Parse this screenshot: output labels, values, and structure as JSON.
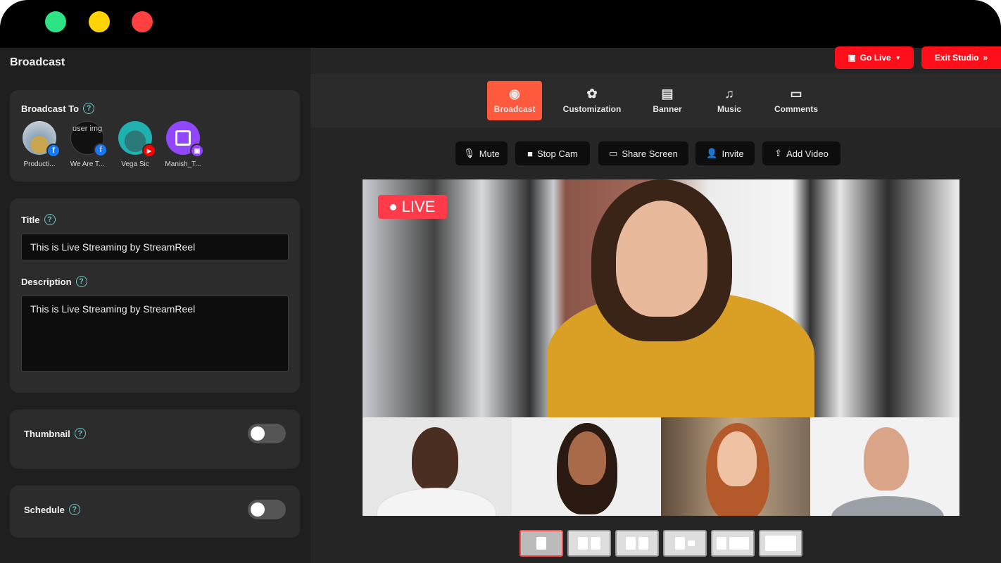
{
  "window": {
    "dot_colors": [
      "#2ee383",
      "#ffd400",
      "#ff4040"
    ]
  },
  "sidebar": {
    "heading": "Broadcast",
    "broadcast_to": {
      "label": "Broadcast To",
      "accounts": [
        {
          "name": "Producti...",
          "platform": "facebook-icon",
          "badge": "f"
        },
        {
          "name": "We Are T...",
          "platform": "facebook-icon",
          "badge": "f",
          "alt": "user img"
        },
        {
          "name": "Vega Sic",
          "platform": "youtube-icon",
          "badge": "▶"
        },
        {
          "name": "Manish_T...",
          "platform": "twitch-icon",
          "badge": "▣"
        }
      ]
    },
    "title": {
      "label": "Title",
      "value": "This is Live Streaming by StreamReel"
    },
    "description": {
      "label": "Description",
      "value": "This is Live Streaming by StreamReel"
    },
    "thumbnail": {
      "label": "Thumbnail",
      "enabled": false
    },
    "schedule": {
      "label": "Schedule",
      "enabled": false
    }
  },
  "header_buttons": {
    "go_live": "Go Live",
    "exit_studio": "Exit Studio"
  },
  "tabs": [
    {
      "label": "Broadcast",
      "icon": "broadcast-icon",
      "active": true
    },
    {
      "label": "Customization",
      "icon": "palette-icon"
    },
    {
      "label": "Banner",
      "icon": "banner-icon"
    },
    {
      "label": "Music",
      "icon": "music-icon"
    },
    {
      "label": "Comments",
      "icon": "comment-icon"
    }
  ],
  "controls": [
    {
      "label": "Mute",
      "icon": "microphone-icon"
    },
    {
      "label": "Stop Cam",
      "icon": "camera-icon"
    },
    {
      "label": "Share Screen",
      "icon": "monitor-icon"
    },
    {
      "label": "Invite",
      "icon": "add-user-icon"
    },
    {
      "label": "Add Video",
      "icon": "upload-icon"
    }
  ],
  "stage": {
    "live_label": "LIVE"
  },
  "layouts": {
    "count": 6,
    "active_index": 0
  }
}
